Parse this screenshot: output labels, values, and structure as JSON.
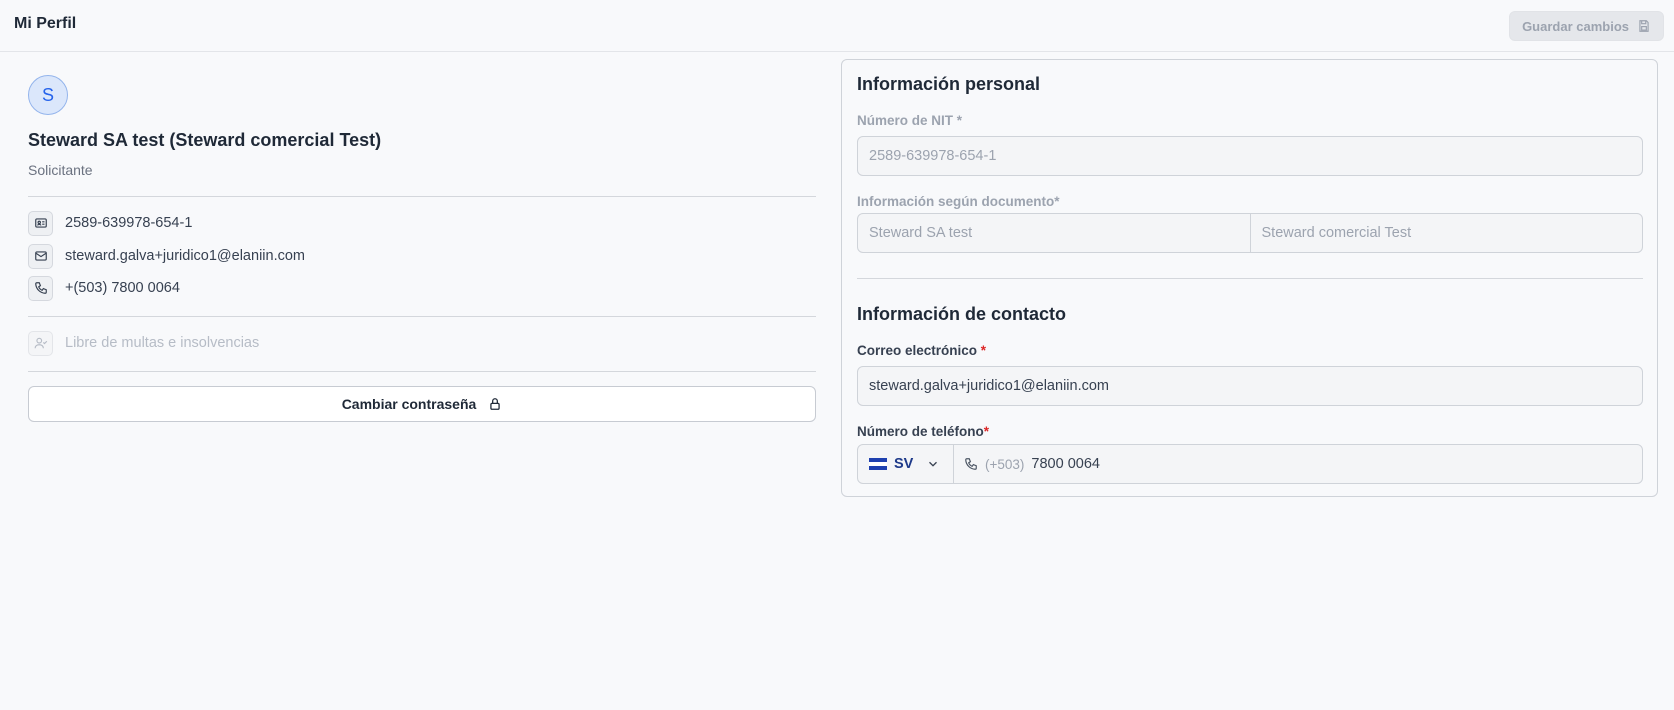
{
  "header": {
    "title": "Mi Perfil",
    "save_label": "Guardar cambios"
  },
  "profile": {
    "avatar_letter": "S",
    "name": "Steward SA test (Steward comercial Test)",
    "role": "Solicitante",
    "nit": "2589-639978-654-1",
    "email": "steward.galva+juridico1@elaniin.com",
    "phone": "+(503) 7800 0064",
    "status": "Libre de multas e insolvencias",
    "change_password_label": "Cambiar contraseña"
  },
  "personal": {
    "title": "Información personal",
    "nit_label": "Número de NIT",
    "nit_required": "*",
    "nit_value": "2589-639978-654-1",
    "doc_label": "Información según documento",
    "doc_required": "*",
    "doc_first": "Steward SA test",
    "doc_second": "Steward comercial Test"
  },
  "contact": {
    "title": "Información de contacto",
    "email_label": "Correo electrónico",
    "email_required": "*",
    "email_value": "steward.galva+juridico1@elaniin.com",
    "phone_label": "Número de teléfono",
    "phone_required": "*",
    "country_code": "SV",
    "phone_prefix": "(+503)",
    "phone_value": "7800 0064"
  },
  "icons": {
    "save": "save-icon",
    "id_card": "id-card-icon",
    "mail": "mail-icon",
    "phone": "phone-icon",
    "user_check": "user-check-icon",
    "lock": "lock-icon",
    "chevron": "chevron-down-icon",
    "flag": "flag-icon"
  },
  "colors": {
    "accent": "#2563eb",
    "required": "#dc2626",
    "background": "#f8f9fb"
  }
}
